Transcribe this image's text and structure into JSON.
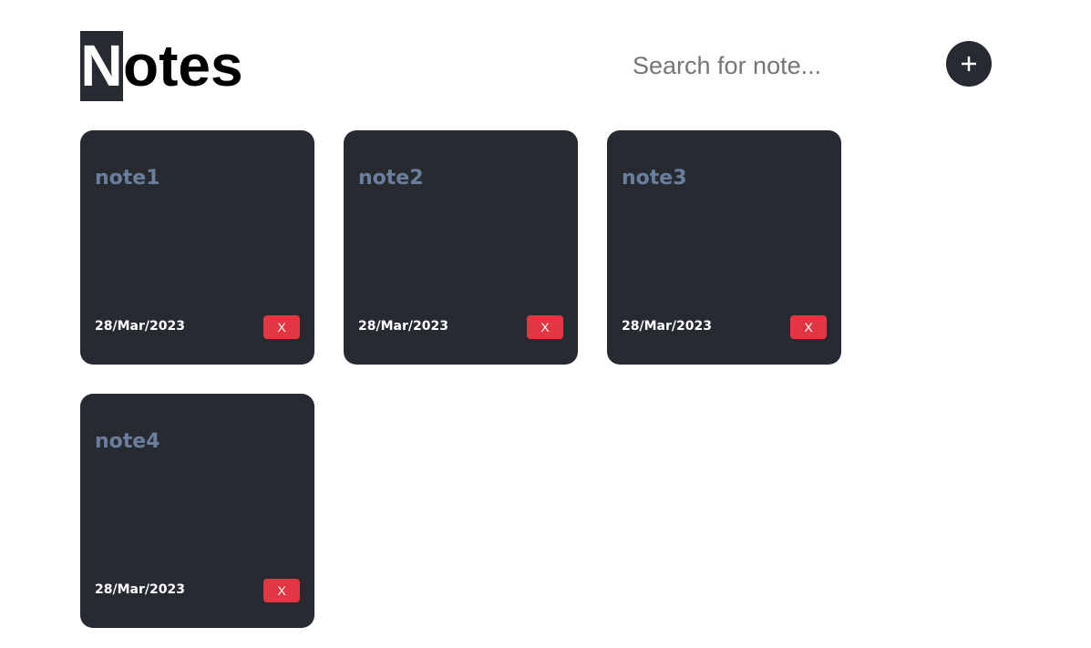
{
  "header": {
    "title_first_letter": "N",
    "title_rest": "otes",
    "search_placeholder": "Search for note...",
    "add_button_icon": "plus-icon"
  },
  "colors": {
    "card_background": "#282a32",
    "card_title": "#6a7f9c",
    "delete_button": "#e23743",
    "add_button": "#282a32"
  },
  "notes": [
    {
      "title": "note1",
      "date": "28/Mar/2023",
      "delete_label": "X"
    },
    {
      "title": "note2",
      "date": "28/Mar/2023",
      "delete_label": "X"
    },
    {
      "title": "note3",
      "date": "28/Mar/2023",
      "delete_label": "X"
    },
    {
      "title": "note4",
      "date": "28/Mar/2023",
      "delete_label": "X"
    }
  ]
}
